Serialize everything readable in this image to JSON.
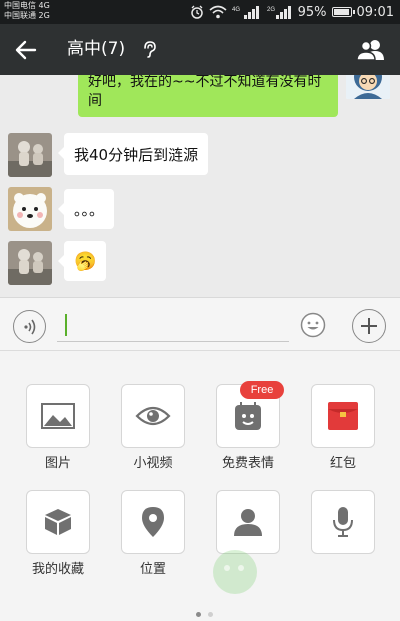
{
  "status_bar": {
    "carrier_1": "中国电信 4G",
    "carrier_2": "中国联通 2G",
    "network_4g": "4G",
    "network_2g": "2G",
    "battery_percent": "95%",
    "battery_level": 0.95,
    "time": "09:01"
  },
  "title_bar": {
    "title": "高中(7)",
    "back_icon": "back-arrow-icon",
    "speaker_icon": "ear-icon",
    "members_icon": "group-members-icon"
  },
  "chat": {
    "self_message": "好吧，我在的~~不过不知道有没有时间",
    "messages": [
      {
        "text": "我40分钟后到涟源"
      },
      {
        "text": "。。。"
      },
      {
        "text": "🥱"
      }
    ]
  },
  "input_bar": {
    "voice_icon": "voice-icon",
    "input_value": "",
    "emoji_icon": "emoji-icon",
    "plus_icon": "plus-icon"
  },
  "panel": {
    "items": [
      {
        "label": "图片",
        "icon": "image-icon"
      },
      {
        "label": "小视频",
        "icon": "eye-icon"
      },
      {
        "label": "免费表情",
        "icon": "sticker-icon",
        "badge": "Free"
      },
      {
        "label": "红包",
        "icon": "red-packet-icon"
      },
      {
        "label": "我的收藏",
        "icon": "favorites-icon"
      },
      {
        "label": "位置",
        "icon": "location-icon"
      },
      {
        "label": "",
        "icon": "contact-card-icon"
      },
      {
        "label": "",
        "icon": "microphone-icon"
      }
    ],
    "page_count": 2,
    "active_page": 1
  },
  "colors": {
    "accent_green": "#a0e75a",
    "title_bar": "#2e3132",
    "badge_red": "#e8413c",
    "red_packet": "#e23a3a"
  }
}
